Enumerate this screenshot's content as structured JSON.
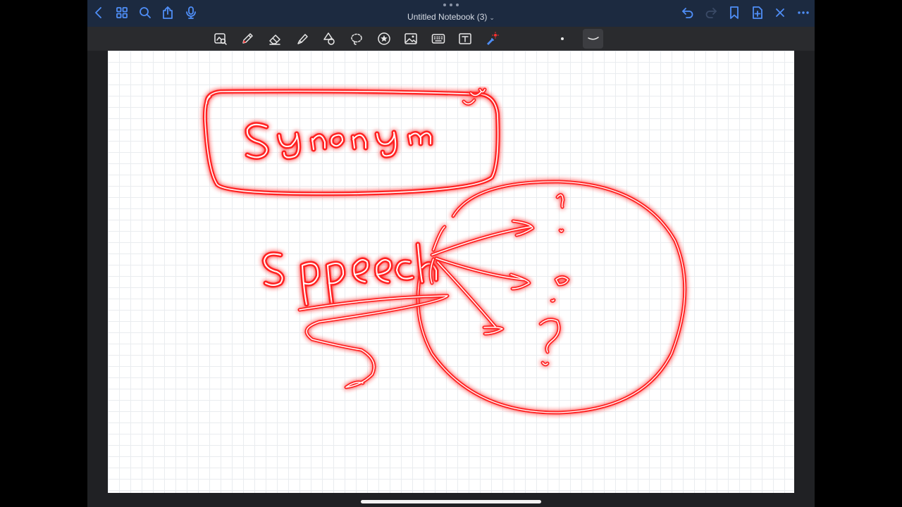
{
  "app": {
    "title": "Untitled Notebook (3)",
    "title_chevron": "⌄"
  },
  "topbar": {
    "left_icons": [
      "back-chevron-icon",
      "grid-view-icon",
      "search-icon",
      "share-icon",
      "microphone-icon"
    ],
    "right_icons": [
      "undo-icon",
      "redo-icon",
      "bookmark-icon",
      "add-page-icon",
      "close-icon",
      "more-icon"
    ]
  },
  "toolbar": {
    "tools": [
      "zoom-window-tool",
      "pen-tool",
      "eraser-tool",
      "highlighter-tool",
      "shapes-tool",
      "lasso-tool",
      "sticker-tool",
      "image-tool",
      "keyboard-tool",
      "text-tool",
      "laser-pointer-tool"
    ],
    "options": [
      "pen-size-dot",
      "stroke-style"
    ],
    "colors": {
      "background": "#2a2b2e",
      "icon": "#e8e8e8",
      "accent": "#4f8ef7"
    }
  },
  "canvas": {
    "ink_color": "#ff2020",
    "strokes": [
      "Synonym",
      "Speech",
      "circle",
      "arrows",
      "punctuation"
    ]
  }
}
